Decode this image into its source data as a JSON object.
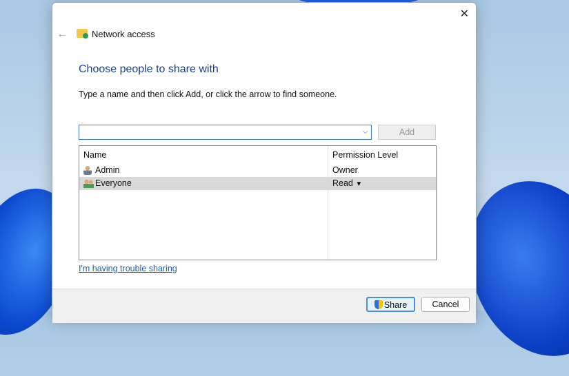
{
  "window": {
    "title": "Network access",
    "close_icon": "close-icon",
    "back_icon": "back-arrow-icon"
  },
  "heading": "Choose people to share with",
  "instruction": "Type a name and then click Add, or click the arrow to find someone.",
  "name_input": {
    "value": "",
    "placeholder": ""
  },
  "add_label": "Add",
  "list": {
    "columns": [
      "Name",
      "Permission Level"
    ],
    "rows": [
      {
        "name": "Admin",
        "permission": "Owner",
        "icon": "user-icon"
      },
      {
        "name": "Everyone",
        "permission": "Read",
        "icon": "group-icon",
        "selected": true
      }
    ]
  },
  "trouble_link": "I'm having trouble sharing",
  "buttons": {
    "share": "Share",
    "cancel": "Cancel"
  }
}
